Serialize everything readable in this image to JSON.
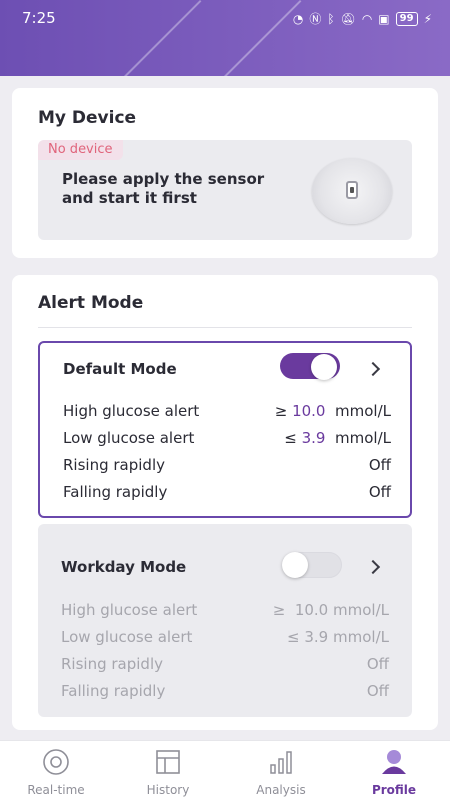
{
  "status_bar": {
    "time": "7:25",
    "battery": "99"
  },
  "device_card": {
    "title": "My Device",
    "badge": "No device",
    "message": "Please apply the sensor and start it first"
  },
  "alert_card": {
    "title": "Alert Mode",
    "modes": [
      {
        "name": "Default Mode",
        "enabled": true,
        "rows": [
          {
            "label": "High glucose alert",
            "op": "≥",
            "value": "10.0",
            "unit": "mmol/L"
          },
          {
            "label": "Low glucose alert",
            "op": "≤",
            "value": "3.9",
            "unit": "mmol/L"
          },
          {
            "label": "Rising rapidly",
            "value": "Off"
          },
          {
            "label": "Falling rapidly",
            "value": "Off"
          }
        ]
      },
      {
        "name": "Workday Mode",
        "enabled": false,
        "rows": [
          {
            "label": "High glucose alert",
            "op": "≥",
            "value": "10.0",
            "unit": "mmol/L"
          },
          {
            "label": "Low glucose alert",
            "op": "≤",
            "value": "3.9",
            "unit": "mmol/L"
          },
          {
            "label": "Rising rapidly",
            "value": "Off"
          },
          {
            "label": "Falling rapidly",
            "value": "Off"
          }
        ]
      }
    ]
  },
  "nav": [
    {
      "label": "Real-time",
      "icon": "realtime-icon"
    },
    {
      "label": "History",
      "icon": "history-icon"
    },
    {
      "label": "Analysis",
      "icon": "analysis-icon"
    },
    {
      "label": "Profile",
      "icon": "profile-icon",
      "active": true
    }
  ],
  "colors": {
    "accent": "#6a3a9e",
    "header": "#7a5cbc",
    "alert_badge": "#e0647b"
  }
}
